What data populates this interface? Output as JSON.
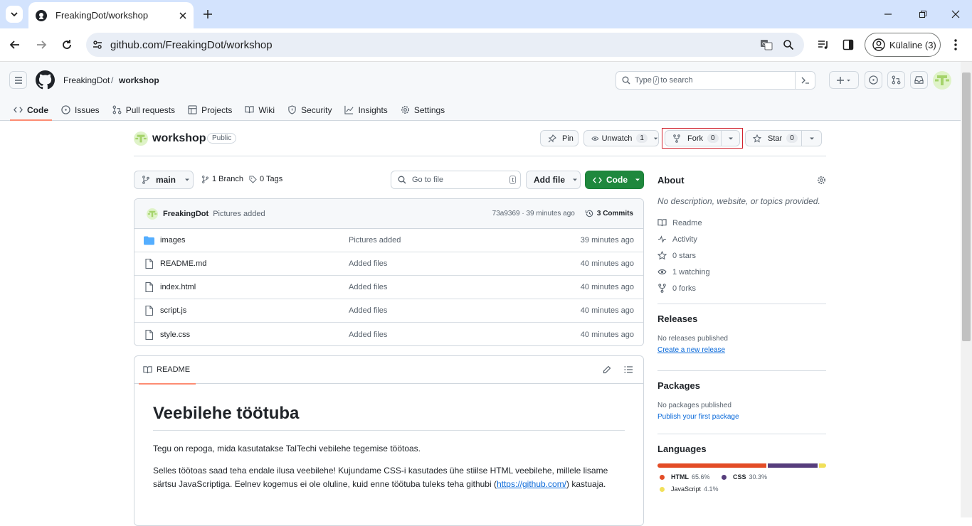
{
  "browser": {
    "tab_title": "FreakingDot/workshop",
    "url": "github.com/FreakingDot/workshop",
    "profile_label": "Külaline (3)"
  },
  "header": {
    "owner": "FreakingDot",
    "separator": "/",
    "repo": "workshop",
    "search_prefix": "Type",
    "search_key": "/",
    "search_suffix": "to search"
  },
  "nav": {
    "tabs": [
      {
        "label": "Code",
        "icon": "code-icon"
      },
      {
        "label": "Issues",
        "icon": "issue-icon"
      },
      {
        "label": "Pull requests",
        "icon": "pull-request-icon"
      },
      {
        "label": "Projects",
        "icon": "table-icon"
      },
      {
        "label": "Wiki",
        "icon": "book-icon"
      },
      {
        "label": "Security",
        "icon": "shield-icon"
      },
      {
        "label": "Insights",
        "icon": "graph-icon"
      },
      {
        "label": "Settings",
        "icon": "gear-icon"
      }
    ]
  },
  "repo": {
    "name": "workshop",
    "visibility": "Public",
    "pin_label": "Pin",
    "unwatch_label": "Unwatch",
    "watch_count": "1",
    "fork_label": "Fork",
    "fork_count": "0",
    "star_label": "Star",
    "star_count": "0"
  },
  "toolbar": {
    "branch": "main",
    "branch_count": "1 Branch",
    "tag_count": "0 Tags",
    "goto_placeholder": "Go to file",
    "goto_key": "t",
    "add_file": "Add file",
    "code_button": "Code"
  },
  "commit": {
    "author": "FreakingDot",
    "message": "Pictures added",
    "hash_time": "73a9369 · 39 minutes ago",
    "commits_label": "3 Commits"
  },
  "files": [
    {
      "name": "images",
      "type": "folder",
      "message": "Pictures added",
      "time": "39 minutes ago"
    },
    {
      "name": "README.md",
      "type": "file",
      "message": "Added files",
      "time": "40 minutes ago"
    },
    {
      "name": "index.html",
      "type": "file",
      "message": "Added files",
      "time": "40 minutes ago"
    },
    {
      "name": "script.js",
      "type": "file",
      "message": "Added files",
      "time": "40 minutes ago"
    },
    {
      "name": "style.css",
      "type": "file",
      "message": "Added files",
      "time": "40 minutes ago"
    }
  ],
  "readme": {
    "tab_label": "README",
    "heading": "Veebilehe töötuba",
    "para1": "Tegu on repoga, mida kasutatakse TalTechi vebilehe tegemise töötoas.",
    "para2_a": "Selles töötoas saad teha endale ilusa veebilehe! Kujundame CSS-i kasutades ühe stiilse HTML veebilehe, millele lisame särtsu JavaScriptiga. Eelnev kogemus ei ole oluline, kuid enne töötuba tuleks teha githubi (",
    "para2_link": "https://github.com/",
    "para2_b": ") kastuaja."
  },
  "about": {
    "title": "About",
    "description": "No description, website, or topics provided.",
    "items": [
      {
        "label": "Readme",
        "icon": "book-icon"
      },
      {
        "label": "Activity",
        "icon": "pulse-icon"
      },
      {
        "label": "0 stars",
        "icon": "star-icon"
      },
      {
        "label": "1 watching",
        "icon": "eye-icon"
      },
      {
        "label": "0 forks",
        "icon": "fork-icon"
      }
    ]
  },
  "releases": {
    "title": "Releases",
    "empty": "No releases published",
    "link": "Create a new release"
  },
  "packages": {
    "title": "Packages",
    "empty": "No packages published",
    "link": "Publish your first package"
  },
  "languages": {
    "title": "Languages",
    "items": [
      {
        "name": "HTML",
        "percent": "65.6%",
        "value": 65.6,
        "color": "#e34c26"
      },
      {
        "name": "CSS",
        "percent": "30.3%",
        "value": 30.3,
        "color": "#563d7c"
      },
      {
        "name": "JavaScript",
        "percent": "4.1%",
        "value": 4.1,
        "color": "#f1e05a"
      }
    ]
  },
  "colors": {
    "accent_green": "#1f883d",
    "link_blue": "#0969da",
    "highlight_red": "#d1242f"
  }
}
